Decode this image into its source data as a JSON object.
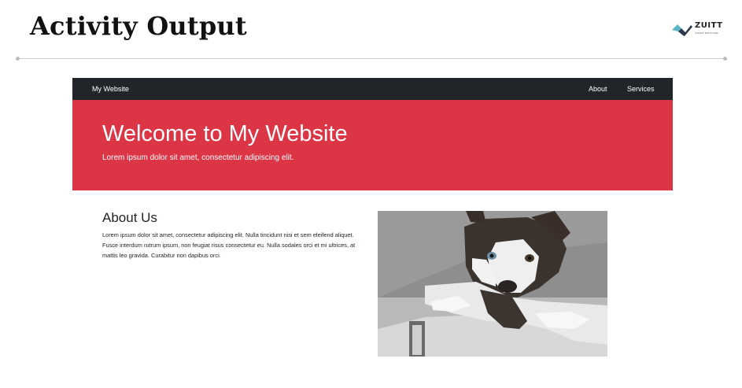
{
  "slide": {
    "title": "Activity Output",
    "logo": {
      "name": "ZUITT",
      "subtitle": "CODING BOOTCAMP"
    }
  },
  "website": {
    "navbar": {
      "brand": "My Website",
      "links": [
        "About",
        "Services"
      ]
    },
    "hero": {
      "title": "Welcome to My Website",
      "subtitle": "Lorem ipsum dolor sit amet, consectetur adipiscing elit."
    },
    "about": {
      "heading": "About Us",
      "body": "Lorem ipsum dolor sit amet, consectetur adipiscing elit. Nulla tincidunt nisi et sem eleifend aliquet. Fusce interdum rutrum ipsum, non feugiat risus consectetur eu. Nulla sodales orci et mi ultrices, at mattis leo gravida. Curabitur non dapibus orci.",
      "image": "husky-puppy-photo"
    }
  },
  "colors": {
    "navbar_bg": "#212529",
    "hero_bg": "#dc3545",
    "divider": "#cfcfcf"
  }
}
